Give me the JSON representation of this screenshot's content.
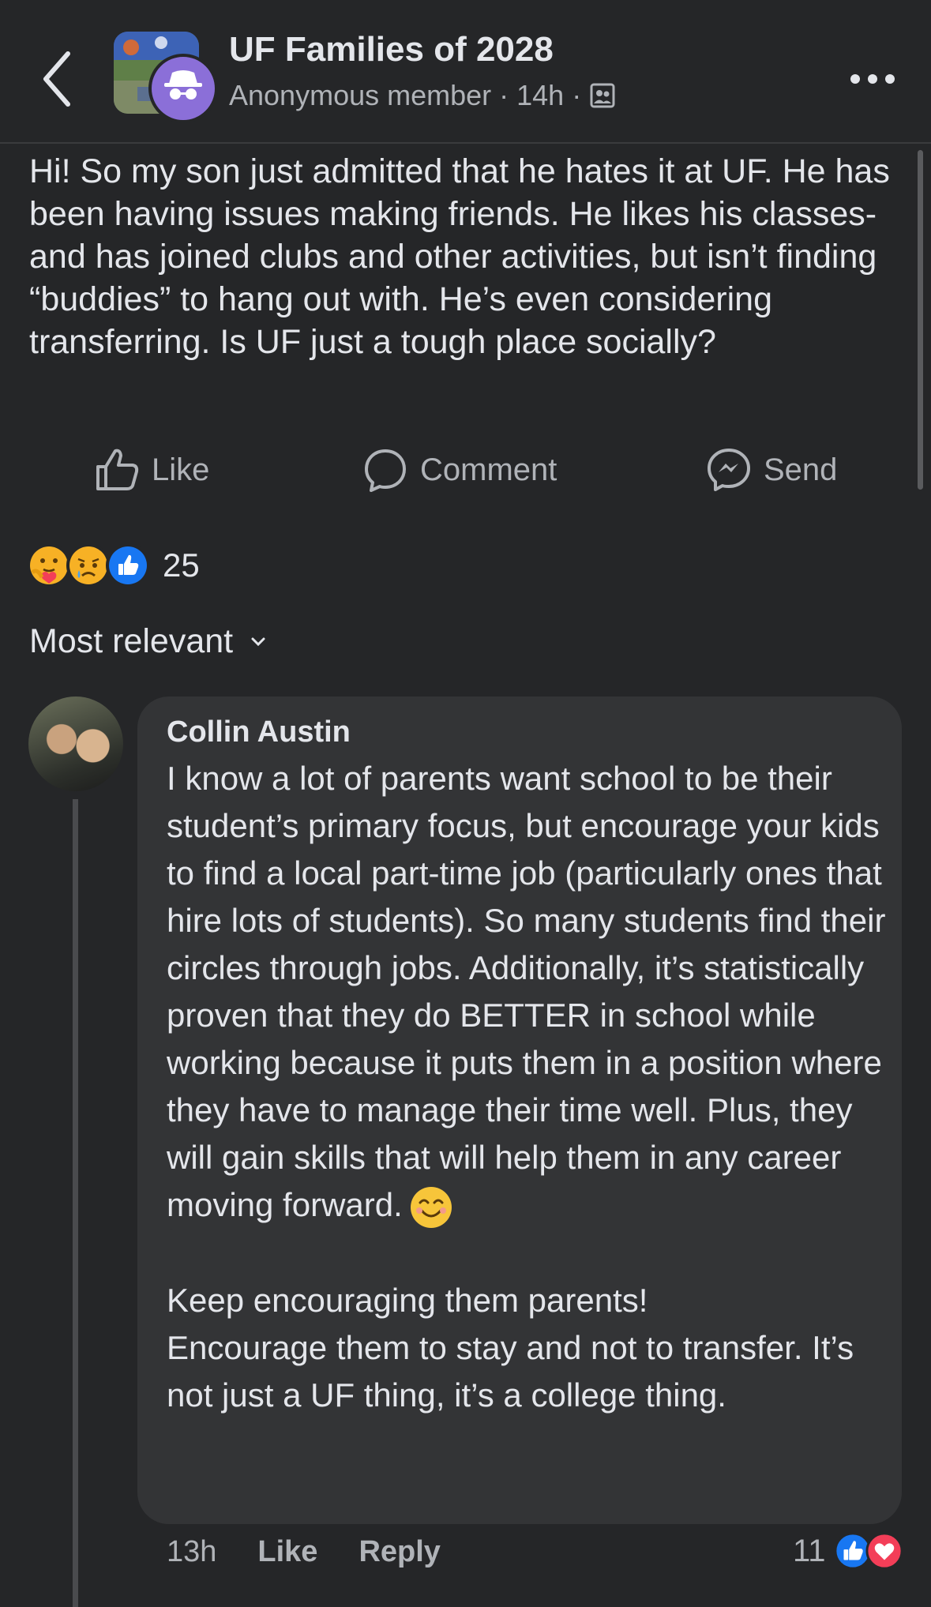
{
  "header": {
    "group_name": "UF Families of 2028",
    "author": "Anonymous member",
    "separator": "·",
    "time": "14h",
    "back_icon": "chevron-left-icon",
    "more_icon": "more-dots-icon",
    "privacy_icon": "group-members-icon"
  },
  "post": {
    "text": "Hi! So my son just admitted that he hates it at UF. He has been having issues making friends. He likes his classes- and has joined clubs and other activities, but isn’t finding “buddies” to hang out with. He’s even considering transferring. Is UF just a tough place socially?"
  },
  "actions": {
    "like": "Like",
    "comment": "Comment",
    "send": "Send"
  },
  "reactions": {
    "icons": [
      "care-emoji",
      "sad-emoji",
      "like-emoji"
    ],
    "count": "25"
  },
  "sort": {
    "label": "Most relevant"
  },
  "comment": {
    "author": "Collin Austin",
    "text_main": "I know a lot of parents want school to be their student’s primary focus, but encourage your kids to find a local part-time job (particularly ones that hire lots of students). So many students find their circles through jobs. Additionally, it’s statistically proven that they do BETTER in school while working because it puts them in a position where they have to manage their time well. Plus, they will gain skills that will help them in any career moving forward.",
    "text_tail": "\n\nKeep encouraging them parents!\nEncourage them to stay and not to transfer. It’s not just a UF thing, it’s a college thing.",
    "time": "13h",
    "like": "Like",
    "reply": "Reply",
    "reaction_count": "11"
  },
  "colors": {
    "background": "#252628",
    "bubble": "#333436",
    "like_blue": "#1877f2",
    "love_red": "#f33e58"
  }
}
